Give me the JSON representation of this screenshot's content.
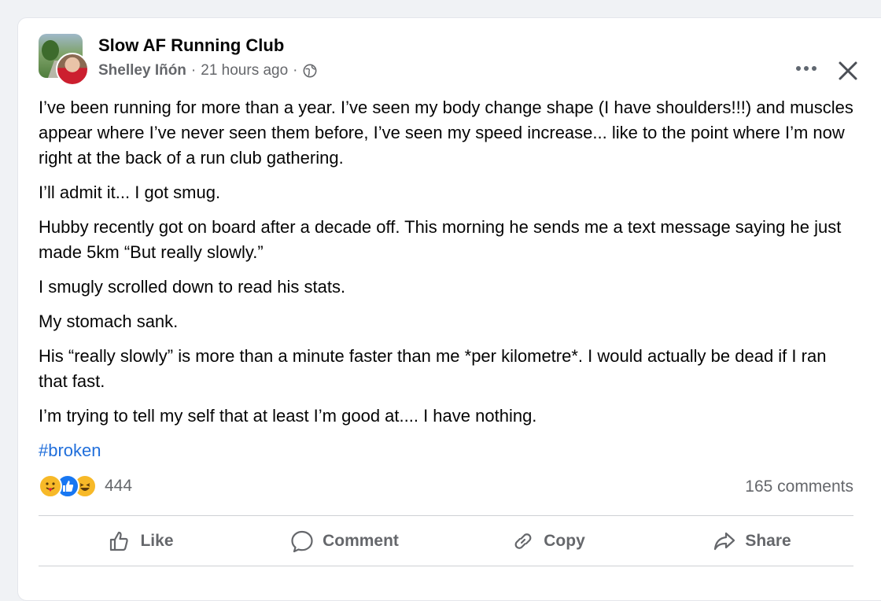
{
  "post": {
    "group_name": "Slow AF Running Club",
    "author": "Shelley Iñón",
    "time": "21 hours ago",
    "separator": "·",
    "privacy_icon": "globe-icon",
    "paragraphs": [
      "I’ve been running for more than a year. I’ve seen my body change shape (I have shoulders!!!) and muscles appear where I’ve never seen them before, I’ve seen my speed increase... like to the point where I’m now right at the back of a run club gathering.",
      "I’ll admit it... I got smug.",
      "Hubby recently got on board after a decade off. This morning he sends me a text message saying he just made 5km “But really slowly.”",
      "I smugly scrolled down to read his stats.",
      "My stomach sank.",
      "His “really slowly” is more than a minute faster than me *per kilometre*. I would actually be dead if I ran that fast.",
      "I’m trying to tell my self that at least I’m good at.... I have nothing."
    ],
    "hashtag": "#broken"
  },
  "stats": {
    "reaction_count": "444",
    "comment_count": "165 comments",
    "reaction_icons": [
      "care-emoji-icon",
      "like-emoji-icon",
      "haha-emoji-icon"
    ]
  },
  "actions": {
    "like": "Like",
    "comment": "Comment",
    "copy": "Copy",
    "share": "Share"
  },
  "colors": {
    "text": "#050505",
    "secondary": "#65676b",
    "link": "#216fdb",
    "like_blue": "#1877f2"
  }
}
